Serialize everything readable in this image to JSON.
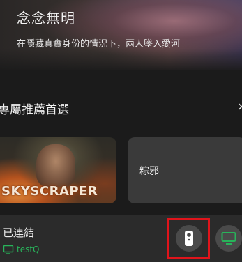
{
  "hero": {
    "title": "念念無明",
    "subtitle": "在隱藏真實身份的情況下，兩人墜入愛河"
  },
  "section": {
    "title": "專屬推薦首選",
    "chevron": "›"
  },
  "cards": [
    {
      "poster_text": "SKYSCRAPER"
    },
    {
      "title": "粽邪"
    }
  ],
  "connection": {
    "status_label": "已連結",
    "device_name": "testQ"
  },
  "colors": {
    "accent_green": "#28b35a",
    "highlight_red": "#e0141b"
  },
  "icons": {
    "remote": "remote-control-icon",
    "tv": "tv-icon"
  }
}
